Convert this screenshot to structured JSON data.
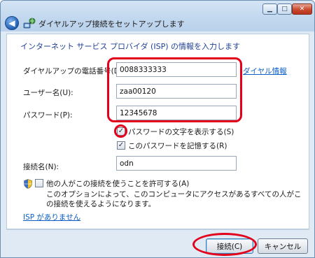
{
  "window": {
    "title": "ダイヤルアップ接続をセットアップします",
    "minimize_glyph": "▁",
    "maximize_glyph": "□",
    "close_glyph": "✕",
    "back_glyph": "◀"
  },
  "instruction": "インターネット サービス プロバイダ (ISP) の情報を入力します",
  "form": {
    "phone_label": "ダイヤルアップの電話番号(D):",
    "phone_value": "0088333333",
    "dialing_rules_link": "ダイヤル情報",
    "username_label": "ユーザー名(U):",
    "username_value": "zaa00120",
    "password_label": "パスワード(P):",
    "password_value": "12345678",
    "show_chars_label": "パスワードの文字を表示する(S)",
    "show_chars_checked": "✓",
    "remember_label": "このパスワードを記憶する(R)",
    "remember_checked": "✓",
    "connection_name_label": "接続名(N):",
    "connection_name_value": "odn",
    "allow_others_label": "他の人がこの接続を使うことを許可する(A)",
    "allow_others_desc": "このオプションによって、このコンピュータにアクセスがあるすべての人がこの接続を使えるようになります。",
    "no_isp_link": "ISP がありません"
  },
  "buttons": {
    "connect": "接続(C)",
    "cancel": "キャンセル"
  },
  "colors": {
    "highlight": "#e2001a",
    "link": "#0d5fc4",
    "instruction": "#1e3f93"
  }
}
